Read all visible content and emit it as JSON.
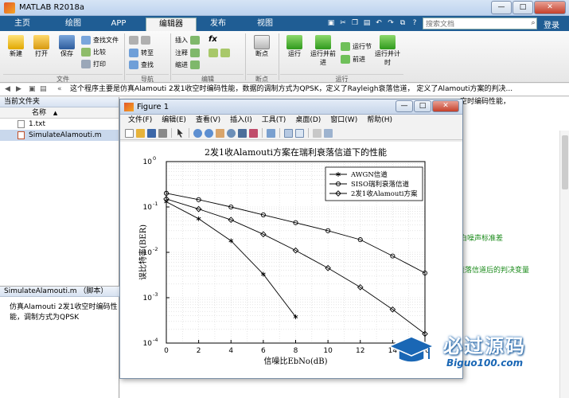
{
  "window": {
    "title": "MATLAB R2018a",
    "min": "—",
    "max": "□",
    "close": "✕"
  },
  "tabs": [
    {
      "label": "主页"
    },
    {
      "label": "绘图"
    },
    {
      "label": "APP"
    },
    {
      "label": "编辑器"
    },
    {
      "label": "发布"
    },
    {
      "label": "视图"
    }
  ],
  "search": {
    "placeholder": "搜索文档"
  },
  "login": "登录",
  "ribbon": {
    "file": {
      "new": "新建",
      "open": "打开",
      "save": "保存",
      "find_files": "查找文件",
      "compare": "比较",
      "print": "打印",
      "group": "文件"
    },
    "nav": {
      "goto": "转至",
      "find": "查找",
      "group": "导航"
    },
    "edit": {
      "insert": "插入",
      "comment": "注释",
      "indent": "缩进",
      "fx": "fx",
      "group": "编辑"
    },
    "breakpoints": {
      "label": "断点",
      "group": "断点"
    },
    "run": {
      "run": "运行",
      "run_advance": "运行并前进",
      "run_section": "运行节",
      "advance": "前进",
      "run_time": "运行并计时",
      "group": "运行"
    }
  },
  "address": {
    "path": "这个程序主要是仿真Alamouti 2发1收空时编码性能，数据的调制方式为QPSK，定义了Rayleigh衰落信道， 定义了Alamouti方案的判决..."
  },
  "left_panel": {
    "title": "当前文件夹",
    "col_name": "名称",
    "col_sort": "▲",
    "files": [
      {
        "name": "1.txt"
      },
      {
        "name": "SimulateAlamouti.m"
      }
    ],
    "detail_title": "SimulateAlamouti.m （脚本）",
    "detail_text": "仿真Alamouti 2发1收空时编码性能，调制方式为QPSK"
  },
  "editor": {
    "tab_text": "空时编码性能，",
    "lines": [
      "斯白噪声标准差",
      "衰落信道后的判决变量"
    ]
  },
  "figure": {
    "title": "Figure 1",
    "menu": [
      "文件(F)",
      "编辑(E)",
      "查看(V)",
      "插入(I)",
      "工具(T)",
      "桌面(D)",
      "窗口(W)",
      "帮助(H)"
    ]
  },
  "chart_data": {
    "type": "line",
    "title": "2发1收Alamouti方案在瑞利衰落信道下的性能",
    "xlabel": "信噪比EbNo(dB)",
    "ylabel": "误比特率(BER)",
    "xlim": [
      0,
      16
    ],
    "ylim": [
      0.0001,
      1
    ],
    "yscale": "log",
    "grid": true,
    "legend_position": "top-right",
    "x_ticks": [
      "0",
      "2",
      "4",
      "6",
      "8",
      "10",
      "12",
      "14",
      "16"
    ],
    "y_ticks": [
      {
        "base": "10",
        "exp": "0",
        "value": 1
      },
      {
        "base": "10",
        "exp": "-1",
        "value": 0.1
      },
      {
        "base": "10",
        "exp": "-2",
        "value": 0.01
      },
      {
        "base": "10",
        "exp": "-3",
        "value": 0.001
      },
      {
        "base": "10",
        "exp": "-4",
        "value": 0.0001
      }
    ],
    "series": [
      {
        "name": "AWGN信道",
        "marker": "star",
        "x": [
          0,
          2,
          4,
          6,
          8
        ],
        "y": [
          0.13,
          0.055,
          0.018,
          0.0033,
          0.00038
        ]
      },
      {
        "name": "SISO瑞利衰落信道",
        "marker": "circle",
        "x": [
          0,
          2,
          4,
          6,
          8,
          10,
          12,
          14,
          16
        ],
        "y": [
          0.2,
          0.145,
          0.1,
          0.067,
          0.045,
          0.03,
          0.019,
          0.0083,
          0.0035
        ]
      },
      {
        "name": "2发1收Alamouti方案",
        "marker": "diamond",
        "x": [
          0,
          2,
          4,
          6,
          8,
          10,
          12,
          14,
          16
        ],
        "y": [
          0.15,
          0.09,
          0.052,
          0.025,
          0.011,
          0.0045,
          0.0017,
          0.00055,
          0.00016
        ]
      }
    ]
  },
  "watermark": {
    "text": "必过源码",
    "url": "Biguo100.com"
  }
}
